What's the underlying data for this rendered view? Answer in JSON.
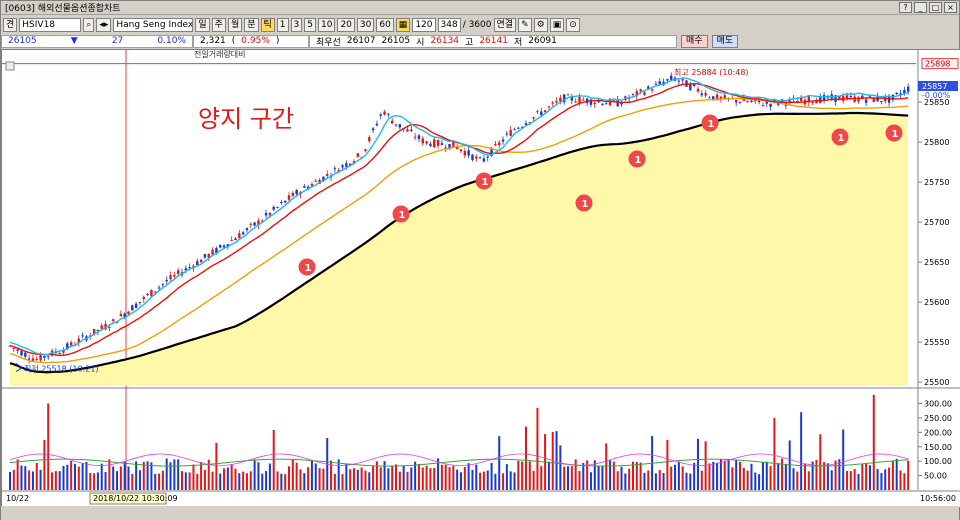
{
  "window": {
    "title": "[0603] 해외선물옵션종합차트"
  },
  "toolbar": {
    "mode": "견",
    "symbol": "HSIV18",
    "name": "Hang Seng Index(18.1",
    "periods": [
      "일",
      "주",
      "월",
      "분",
      "틱"
    ],
    "active_period": "틱",
    "intervals": [
      "1",
      "3",
      "5",
      "10",
      "20",
      "30",
      "60"
    ],
    "count": "120",
    "shown": "348",
    "total": "/ 3600",
    "link": "연결"
  },
  "quote": {
    "price": "26105",
    "arrow": "▼",
    "change": "27",
    "pct": "0.10%",
    "volume": "2,321",
    "vol_pct_open": "(",
    "vol_pct": "0.95%",
    "vol_pct_close": ")",
    "pref_label": "최우선",
    "bid": "26107",
    "ask": "26105",
    "open_label": "시",
    "open": "26134",
    "high_label": "고",
    "high": "26141",
    "low_label": "저",
    "low": "26091",
    "buy": "매수",
    "sell": "매도",
    "subtitle": "전일거래량대비"
  },
  "annotation": {
    "text": "양지 구간",
    "markers": [
      "1",
      "1",
      "1",
      "1",
      "1",
      "1",
      "1",
      "1"
    ]
  },
  "chart_data": {
    "type": "candlestick",
    "y_axis": [
      "25850",
      "25800",
      "25750",
      "25700",
      "25650",
      "25600",
      "25550",
      "25500"
    ],
    "ylim": [
      25495,
      25905
    ],
    "last_price": "25857",
    "last_pct": "-0.00%",
    "top_price": "25898",
    "high_label": "최고 25884 (10:48)",
    "low_label": "최저 25518 (10:21)",
    "vol_axis": [
      "300.00",
      "250.00",
      "200.00",
      "150.00",
      "100.00",
      "50.00"
    ],
    "vol_ylim": [
      0,
      340
    ],
    "series_ma": [
      {
        "color": "#000000"
      },
      {
        "color": "#f0a000"
      },
      {
        "color": "#e81010"
      },
      {
        "color": "#20b8e8"
      }
    ],
    "fill_color": "#fff8a8",
    "x_start": "10/22",
    "x_cursor": "2018/10/22 10:30:09",
    "x_end": "10:56:00"
  }
}
